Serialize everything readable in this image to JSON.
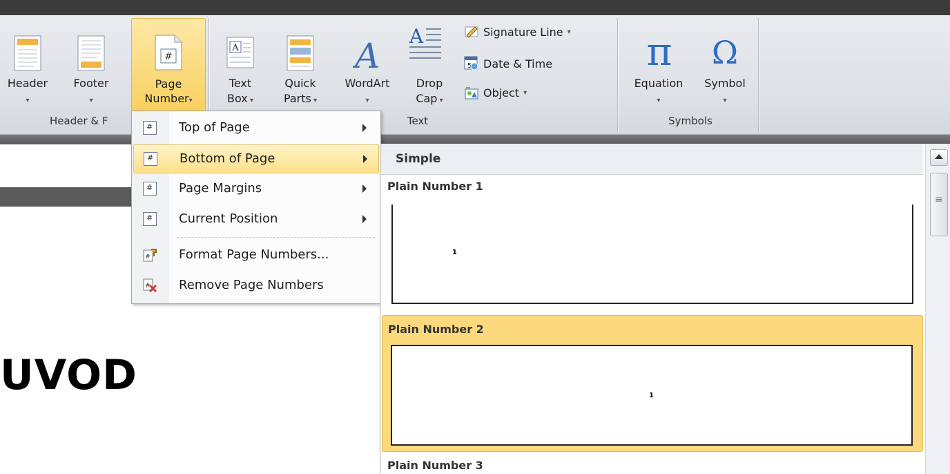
{
  "ribbon": {
    "groups": {
      "header_footer": {
        "label": "Header & F"
      },
      "text": {
        "label": "Text"
      },
      "symbols": {
        "label": "Symbols"
      }
    },
    "buttons": {
      "header": "Header",
      "footer": "Footer",
      "page_line1": "Page",
      "page_line2": "Number",
      "textbox_line1": "Text",
      "textbox_line2": "Box",
      "quick_line1": "Quick",
      "quick_line2": "Parts",
      "wordart": "WordArt",
      "dropcap_line1": "Drop",
      "dropcap_line2": "Cap",
      "signature_line": "Signature Line",
      "date_time": "Date & Time",
      "object": "Object",
      "equation": "Equation",
      "symbol": "Symbol"
    }
  },
  "menu": {
    "items": [
      {
        "label": "Top of Page",
        "submenu": true
      },
      {
        "label": "Bottom of Page",
        "submenu": true,
        "highlighted": true
      },
      {
        "label": "Page Margins",
        "submenu": true
      },
      {
        "label": "Current Position",
        "submenu": true
      },
      {
        "label": "Format Page Numbers...",
        "submenu": false
      },
      {
        "label": "Remove Page Numbers",
        "submenu": false
      }
    ]
  },
  "gallery": {
    "section": "Simple",
    "items": [
      {
        "title": "Plain Number 1",
        "number": "1"
      },
      {
        "title": "Plain Number 2",
        "number": "1"
      },
      {
        "title": "Plain Number 3"
      }
    ]
  },
  "document": {
    "heading": "UVOD"
  }
}
